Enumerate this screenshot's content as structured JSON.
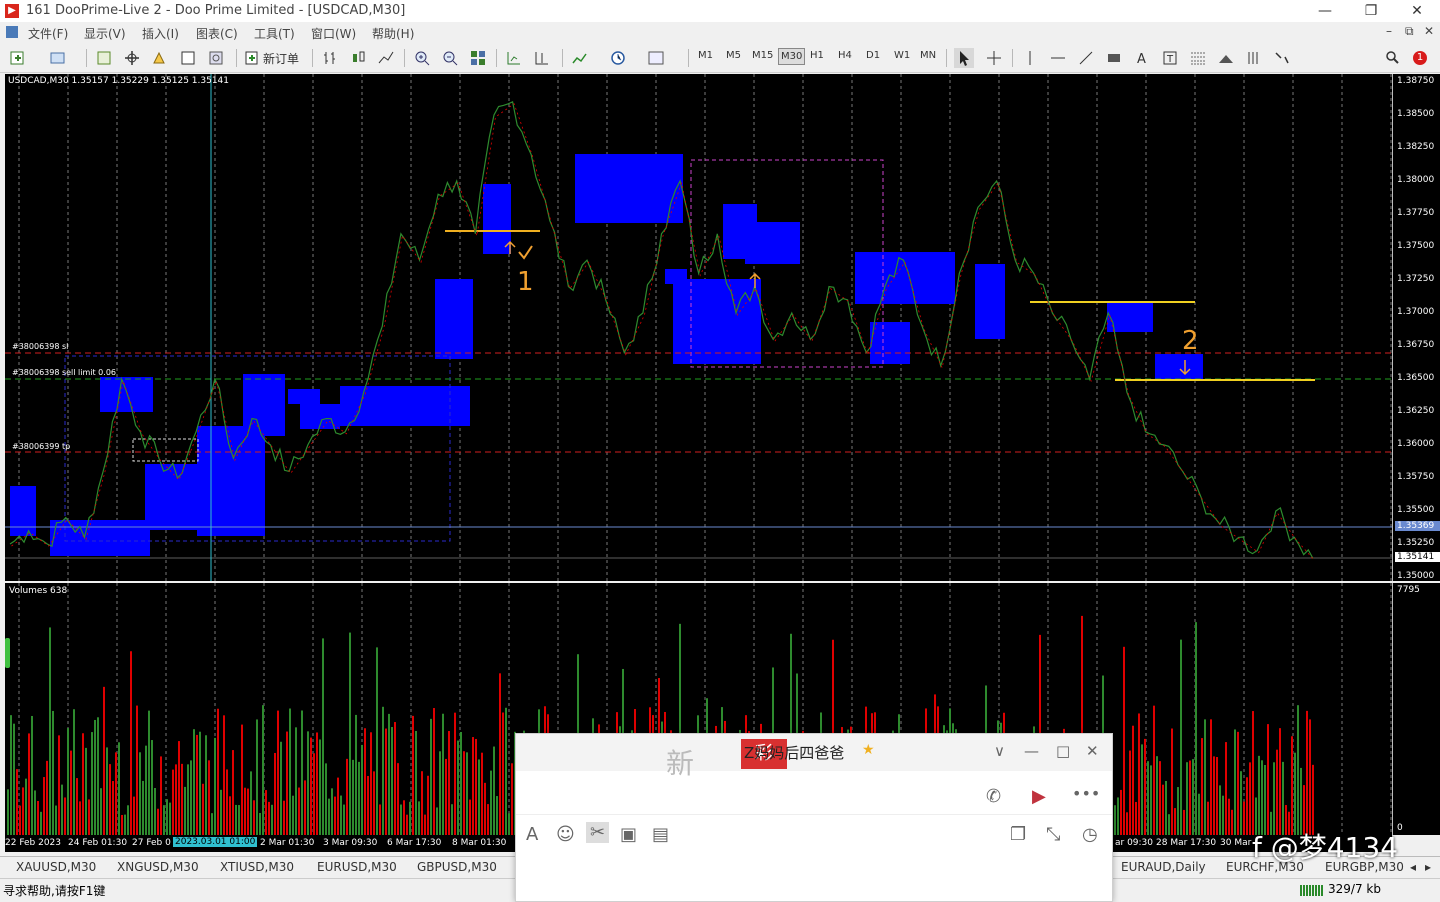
{
  "window": {
    "app_icon": "▶",
    "title": "161      DooPrime-Live 2 - Doo Prime Limited - [USDCAD,M30]",
    "minimize": "—",
    "maximize": "❐",
    "close": "✕"
  },
  "menu": {
    "items": [
      "文件(F)",
      "显示(V)",
      "插入(I)",
      "图表(C)",
      "工具(T)",
      "窗口(W)",
      "帮助(H)"
    ],
    "doc_controls": [
      "–",
      "⧉",
      "✕"
    ]
  },
  "toolbar": {
    "new_order_label": "新订单",
    "timeframes": [
      "M1",
      "M5",
      "M15",
      "M30",
      "H1",
      "H4",
      "D1",
      "W1",
      "MN"
    ],
    "active_timeframe": "M30",
    "notification_count": "1"
  },
  "chart": {
    "info": "USDCAD,M30  1.35157 1.35229 1.35125 1.35141",
    "order_labels": [
      "#38006398 sl",
      "#38006398 sell limit 0.06",
      "#38006399 tp"
    ],
    "annotations": [
      "1",
      "2"
    ],
    "volume_label": "Volumes 638",
    "volume_max": "7795",
    "volume_min": "0",
    "current_price": "1.35141",
    "line_price": "1.35369",
    "colors": {
      "background": "#000000",
      "zone": "#0000ff",
      "up": "#2e8b2e",
      "down": "#e00000",
      "level": "#ffb400"
    }
  },
  "chart_data": {
    "type": "line",
    "title": "USDCAD,M30",
    "ylim": [
      1.35,
      1.3875
    ],
    "y_ticks": [
      "1.38750",
      "1.38500",
      "1.38250",
      "1.38000",
      "1.37750",
      "1.37500",
      "1.37250",
      "1.37000",
      "1.36750",
      "1.36500",
      "1.36250",
      "1.36000",
      "1.35750",
      "1.35500",
      "1.35250",
      "1.35000"
    ],
    "x_ticks": [
      "22 Feb 2023",
      "24 Feb 01:30",
      "27 Feb 0",
      "2023.03.01 01:00",
      "2 Mar 01:30",
      "3 Mar 09:30",
      "6 Mar 17:30",
      "8 Mar 01:30",
      "ar 09:30",
      "28 Mar 17:30",
      "30 Mar"
    ],
    "series": [
      {
        "values": [
          1.3525,
          1.3535,
          1.3525,
          1.3545,
          1.353,
          1.358,
          1.365,
          1.361,
          1.359,
          1.3575,
          1.361,
          1.365,
          1.359,
          1.362,
          1.36,
          1.358,
          1.36,
          1.362,
          1.361,
          1.364,
          1.369,
          1.376,
          1.374,
          1.379,
          1.38,
          1.376,
          1.385,
          1.386,
          1.382,
          1.377,
          1.372,
          1.374,
          1.371,
          1.367,
          1.37,
          1.376,
          1.38,
          1.373,
          1.376,
          1.37,
          1.372,
          1.368,
          1.37,
          1.368,
          1.372,
          1.371,
          1.367,
          1.372,
          1.374,
          1.369,
          1.366,
          1.373,
          1.378,
          1.38,
          1.374,
          1.373,
          1.37,
          1.368,
          1.365,
          1.37,
          1.364,
          1.361,
          1.36,
          1.358,
          1.356,
          1.354,
          1.353,
          1.352,
          1.355,
          1.353,
          1.3514
        ]
      }
    ]
  },
  "tabs": [
    "XAUUSD,M30",
    "XNGUSD,M30",
    "XTIUSD,M30",
    "EURUSD,M30",
    "GBPUSD,M30",
    "EURAUD,Daily",
    "EURCHF,M30",
    "EURGBP,M30"
  ],
  "tab_scroll": [
    "◂",
    "▸"
  ],
  "status": {
    "help": "寻求帮助,请按F1键",
    "traffic": "329/7 kb"
  },
  "chat": {
    "title": "Z妈妈后四爸爸",
    "badge": "彩",
    "header_art": "新",
    "controls": [
      "∨",
      "—",
      "□",
      "✕"
    ],
    "call_icons": [
      "✆",
      "▶",
      "•••"
    ],
    "tool_icons": [
      "A",
      "☺",
      "✂",
      "▣",
      "▤"
    ],
    "right_icons": [
      "❐",
      "⤡",
      "◷"
    ]
  },
  "watermark": "f @梦4134"
}
